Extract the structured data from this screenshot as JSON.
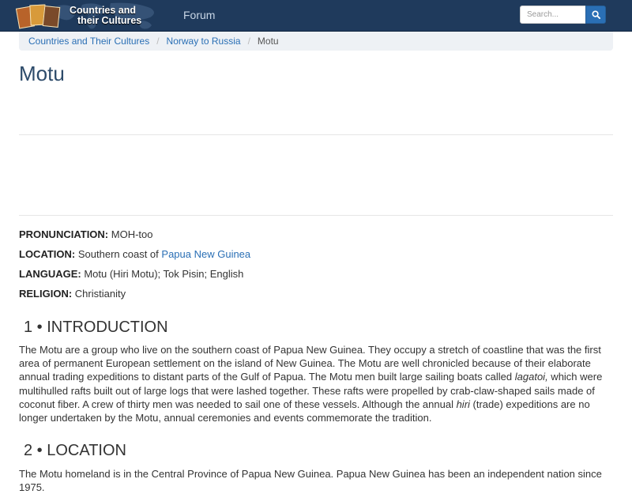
{
  "header": {
    "logo_line1": "Countries and",
    "logo_line2": "their Cultures",
    "nav_forum": "Forum",
    "search_placeholder": "Search..."
  },
  "breadcrumb": {
    "items": [
      "Countries and Their Cultures",
      "Norway to Russia"
    ],
    "current": "Motu"
  },
  "page_title": "Motu",
  "facts": {
    "pronunciation_label": "PRONUNCIATION:",
    "pronunciation_value": "MOH-too",
    "location_label": "LOCATION:",
    "location_value": "Southern coast of",
    "location_link": "Papua New Guinea",
    "language_label": "LANGUAGE:",
    "language_value": "Motu (Hiri Motu); Tok Pisin; English",
    "religion_label": "RELIGION:",
    "religion_value": "Christianity"
  },
  "sections": {
    "intro_heading": "1 • INTRODUCTION",
    "intro_text_1": "The Motu are a group who live on the southern coast of Papua New Guinea. They occupy a stretch of coastline that was the first area of permanent European settlement on the island of New Guinea. The Motu are well chronicled because of their elaborate annual trading expeditions to distant parts of the Gulf of Papua. The Motu men built large sailing boats called ",
    "intro_term_1": "lagatoi,",
    "intro_text_2": " which were multihulled rafts built out of large logs that were lashed together. These rafts were propelled by crab-claw-shaped sails made of coconut fiber. A crew of thirty men was needed to sail one of these vessels. Although the annual ",
    "intro_term_2": "hiri",
    "intro_text_3": " (trade) expeditions are no longer undertaken by the Motu, annual ceremonies and events commemorate the tradition.",
    "location_heading": "2 • LOCATION",
    "location_text": "The Motu homeland is in the Central Province of Papua New Guinea. Papua New Guinea has been an independent nation since 1975."
  },
  "colors": {
    "navbar": "#1f3a5c",
    "link": "#2a6fb5",
    "title": "#2d4b6a",
    "search_button": "#2a6fb5"
  },
  "icons": {
    "search": "search-icon",
    "logo": "logo-icon"
  }
}
